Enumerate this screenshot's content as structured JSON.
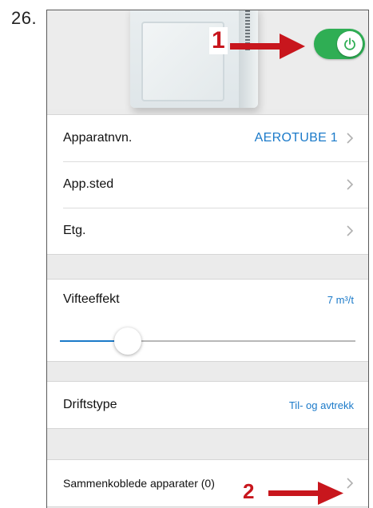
{
  "step_number": "26.",
  "annotations": {
    "marker_1": "1",
    "marker_2": "2",
    "color": "#c8161d"
  },
  "header": {
    "power_toggle": {
      "state": "on",
      "color": "#2fae54",
      "icon": "power-icon"
    }
  },
  "device_info": {
    "rows": [
      {
        "label": "Apparatnvn.",
        "value": "AEROTUBE 1"
      },
      {
        "label": "App.sted",
        "value": ""
      },
      {
        "label": "Etg.",
        "value": ""
      }
    ]
  },
  "fan": {
    "label": "Vifteeffekt",
    "value": "7 m³/t",
    "slider_level": 0.23
  },
  "operation": {
    "label": "Driftstype",
    "value": "Til- og avtrekk"
  },
  "linked": {
    "label": "Sammenkoblede apparater (0)"
  },
  "colors": {
    "accent_blue": "#1b7ac9",
    "toggle_green": "#2fae54",
    "annotation_red": "#c8161d"
  }
}
